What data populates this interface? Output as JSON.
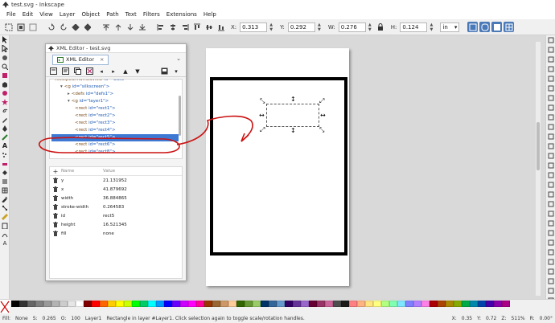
{
  "window": {
    "title": "test.svg - Inkscape"
  },
  "menu": [
    "File",
    "Edit",
    "View",
    "Layer",
    "Object",
    "Path",
    "Text",
    "Filters",
    "Extensions",
    "Help"
  ],
  "toolbar": {
    "x_label": "X:",
    "x_value": "0.313",
    "y_label": "Y:",
    "y_value": "0.292",
    "w_label": "W:",
    "w_value": "0.276",
    "h_label": "H:",
    "h_value": "0.124",
    "unit": "in"
  },
  "xml_editor": {
    "window_title": "XML Editor - test.svg",
    "tab_label": "XML Editor",
    "tree": [
      {
        "indent": 0,
        "expander": "",
        "tag": "<sodipodi:namedview",
        "attr": "id=\"base\"",
        "clipped": true
      },
      {
        "indent": 1,
        "expander": "▾",
        "tag": "<g",
        "attr": "id=\"silkscreen\">"
      },
      {
        "indent": 2,
        "expander": "▸",
        "tag": "<defs",
        "attr": "id=\"defs1\">"
      },
      {
        "indent": 2,
        "expander": "▾",
        "tag": "<g",
        "attr": "id=\"layer1\">"
      },
      {
        "indent": 3,
        "expander": "",
        "tag": "<rect",
        "attr": "id=\"rect1\">"
      },
      {
        "indent": 3,
        "expander": "",
        "tag": "<rect",
        "attr": "id=\"rect2\">"
      },
      {
        "indent": 3,
        "expander": "",
        "tag": "<rect",
        "attr": "id=\"rect3\">"
      },
      {
        "indent": 3,
        "expander": "",
        "tag": "<rect",
        "attr": "id=\"rect4\">"
      },
      {
        "indent": 3,
        "expander": "",
        "tag": "<rect",
        "attr": "id=\"rect5\">",
        "selected": true
      },
      {
        "indent": 3,
        "expander": "",
        "tag": "<rect",
        "attr": "id=\"rect6\">"
      },
      {
        "indent": 3,
        "expander": "",
        "tag": "<rect",
        "attr": "id=\"rect8\">"
      }
    ],
    "attr_header": {
      "name": "Name",
      "value": "Value"
    },
    "attributes": [
      {
        "name": "y",
        "value": "21.131952"
      },
      {
        "name": "x",
        "value": "41.879692"
      },
      {
        "name": "width",
        "value": "36.884865"
      },
      {
        "name": "stroke-width",
        "value": "0.264583"
      },
      {
        "name": "id",
        "value": "rect5"
      },
      {
        "name": "height",
        "value": "16.521345"
      },
      {
        "name": "fill",
        "value": "none"
      }
    ]
  },
  "status": {
    "fill_label": "Fill:",
    "fill_value": "None",
    "stroke_label": "S:",
    "stroke_value": "0.265",
    "opacity_label": "O:",
    "opacity_value": "100",
    "layer": "Layer1",
    "message": "Rectangle in layer #Layer1. Click selection again to toggle scale/rotation handles.",
    "x_label": "X:",
    "x_value": "0.35",
    "y_label": "Y:",
    "y_value": "0.72",
    "z_label": "Z:",
    "zoom": "511%",
    "r_label": "R:",
    "rotation": "0.00°"
  },
  "colors": {
    "selection_highlight": "#3d79d3",
    "annotation_red": "#cc1111",
    "active_button": "#4a79b8"
  },
  "palette": [
    "#000000",
    "#333333",
    "#666666",
    "#808080",
    "#999999",
    "#b3b3b3",
    "#cccccc",
    "#e6e6e6",
    "#ffffff",
    "#800000",
    "#ff0000",
    "#ff6600",
    "#ffcc00",
    "#ffff00",
    "#ccff00",
    "#00ff00",
    "#00cc66",
    "#00ffff",
    "#0099ff",
    "#0000ff",
    "#6600ff",
    "#cc00ff",
    "#ff00ff",
    "#ff0099",
    "#993300",
    "#996633",
    "#cc9966",
    "#ffcc99",
    "#336600",
    "#669933",
    "#99cc66",
    "#003366",
    "#336699",
    "#6699cc",
    "#330066",
    "#663399",
    "#9966cc",
    "#660033",
    "#993366",
    "#cc6699",
    "#4d4d4d",
    "#1a1a1a",
    "#ff8080",
    "#ffb380",
    "#ffe680",
    "#ffff80",
    "#b3ff80",
    "#80ffb3",
    "#80e6ff",
    "#8080ff",
    "#b380ff",
    "#ff80e6",
    "#aa0000",
    "#aa4400",
    "#aa8800",
    "#88aa00",
    "#00aa44",
    "#0088aa",
    "#0044aa",
    "#4400aa",
    "#8800aa",
    "#aa0088"
  ]
}
